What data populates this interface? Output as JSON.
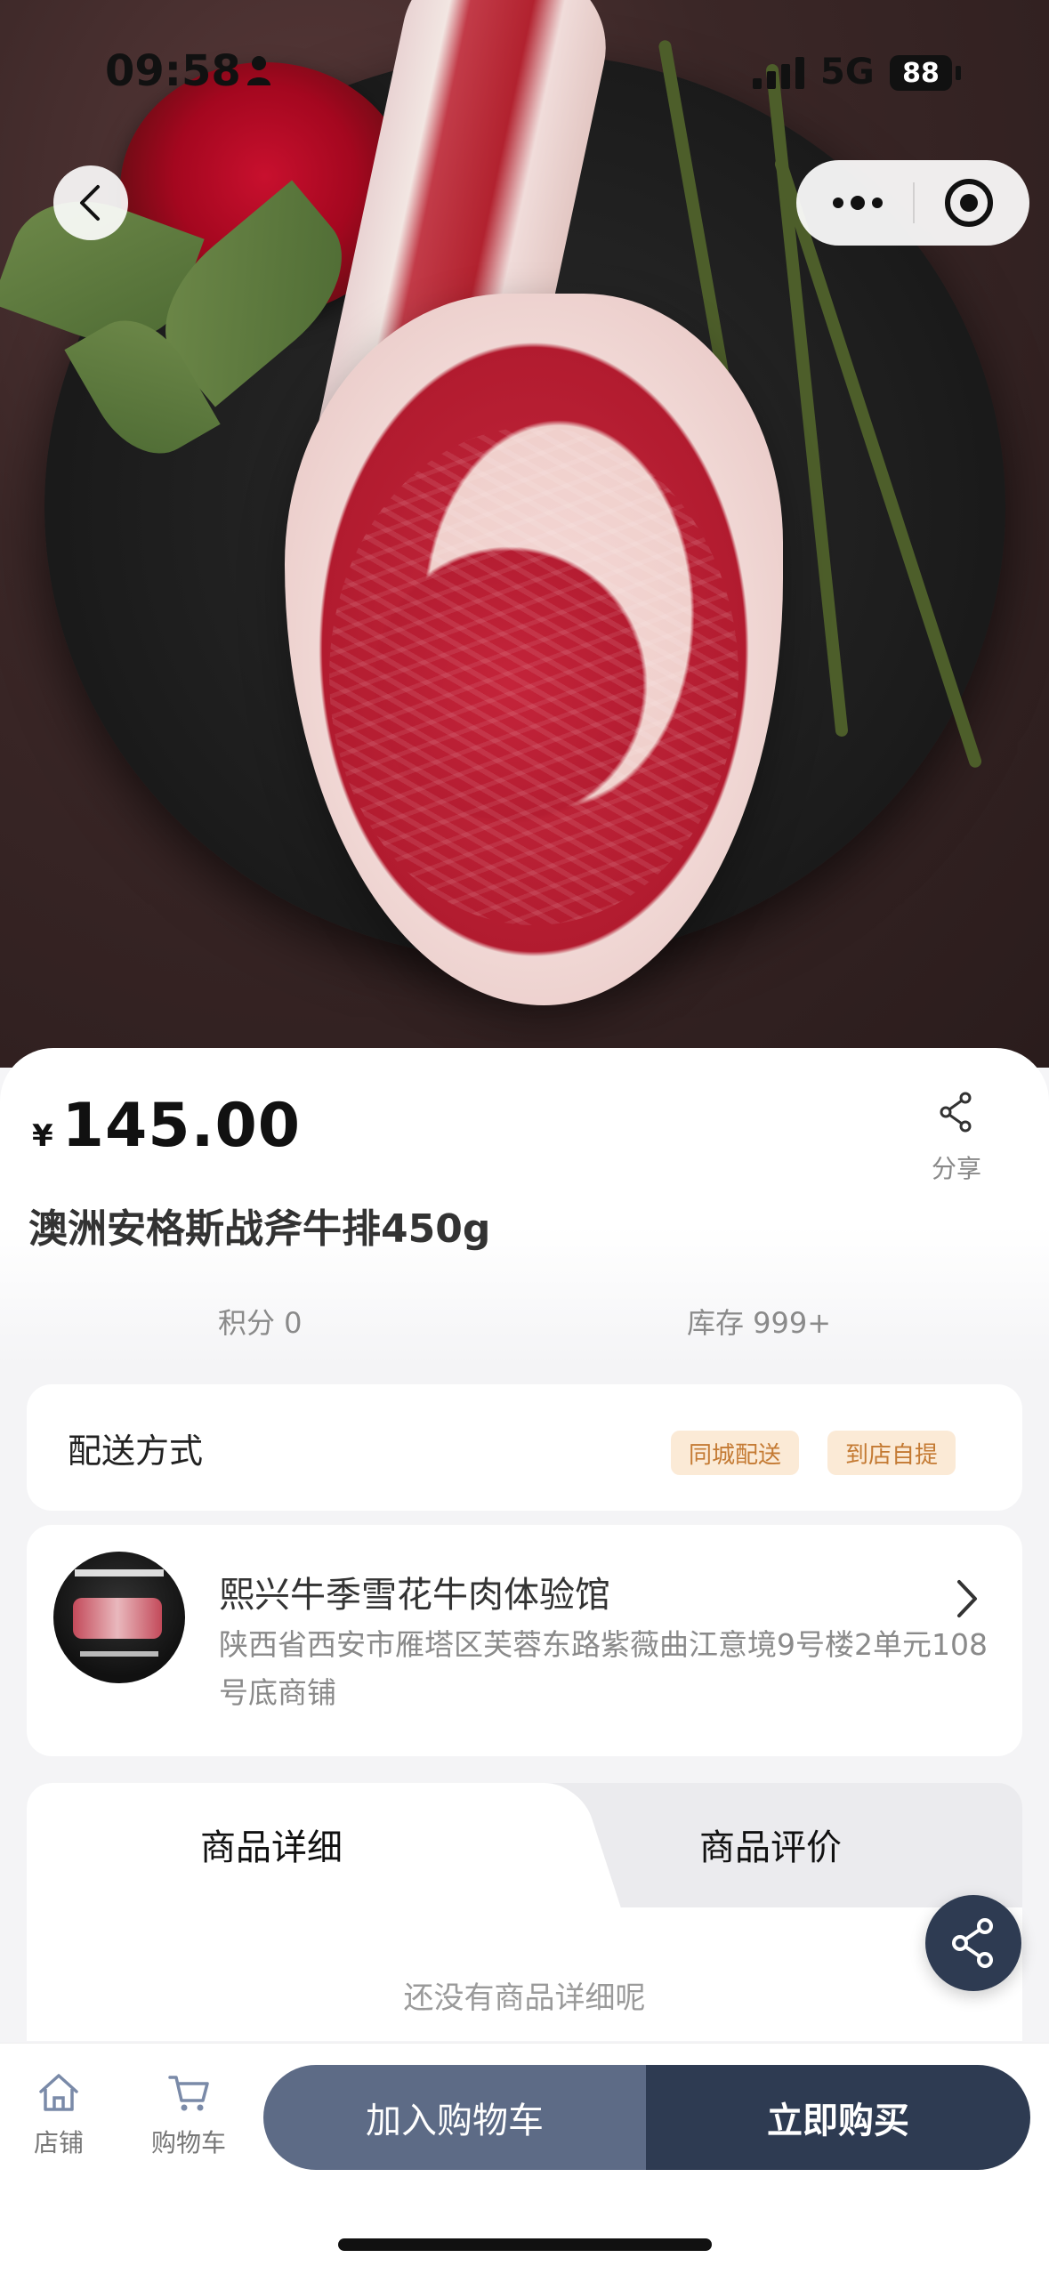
{
  "status": {
    "time": "09:58",
    "network": "5G",
    "battery": "88"
  },
  "product": {
    "currency": "¥",
    "price": "145.00",
    "title": "澳洲安格斯战斧牛排450g",
    "points": "积分 0",
    "stock": "库存 999+",
    "share_label": "分享"
  },
  "delivery": {
    "label": "配送方式",
    "options": [
      "同城配送",
      "到店自提"
    ]
  },
  "store": {
    "name": "熙兴牛季雪花牛肉体验馆",
    "address": "陕西省西安市雁塔区芙蓉东路紫薇曲江意境9号楼2单元108号底商铺"
  },
  "tabs": [
    "商品详细",
    "商品评价"
  ],
  "detail_empty": "还没有商品详细呢",
  "bottom": {
    "store_label": "店铺",
    "cart_label": "购物车",
    "add_to_cart": "加入购物车",
    "buy_now": "立即购买"
  },
  "colors": {
    "primary": "#2e3b52",
    "secondary": "#5d6b86",
    "tag_bg": "#fbead6",
    "tag_text": "#c47a33"
  }
}
